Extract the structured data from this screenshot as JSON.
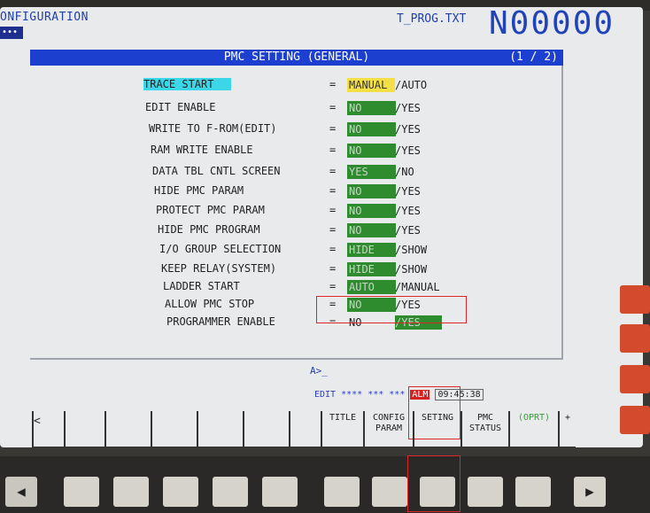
{
  "header": {
    "title": "ONFIGURATION",
    "dots": "•••",
    "program_file": "T_PROG.TXT",
    "program_number": "N00000"
  },
  "titlebar": {
    "title": "PMC SETTING (GENERAL)",
    "page": "(1 / 2)"
  },
  "settings": [
    {
      "label": "TRACE START",
      "eq": "=",
      "opt1": "MANUAL",
      "opt2": "/AUTO",
      "selected": 1,
      "highlight": true
    },
    {
      "label": "EDIT ENABLE",
      "eq": "=",
      "opt1": "NO",
      "opt2": "/YES",
      "selected": 1
    },
    {
      "label": "WRITE TO F-ROM(EDIT)",
      "eq": "=",
      "opt1": "NO",
      "opt2": "/YES",
      "selected": 1
    },
    {
      "label": "RAM WRITE ENABLE",
      "eq": "=",
      "opt1": "NO",
      "opt2": "/YES",
      "selected": 1
    },
    {
      "label": "DATA TBL CNTL SCREEN",
      "eq": "=",
      "opt1": "YES",
      "opt2": "/NO",
      "selected": 1
    },
    {
      "label": "HIDE PMC PARAM",
      "eq": "=",
      "opt1": "NO",
      "opt2": "/YES",
      "selected": 1
    },
    {
      "label": "PROTECT PMC PARAM",
      "eq": "=",
      "opt1": "NO",
      "opt2": "/YES",
      "selected": 1
    },
    {
      "label": "HIDE PMC PROGRAM",
      "eq": "=",
      "opt1": "NO",
      "opt2": "/YES",
      "selected": 1
    },
    {
      "label": "I/O GROUP SELECTION",
      "eq": "=",
      "opt1": "HIDE",
      "opt2": "/SHOW",
      "selected": 1
    },
    {
      "label": "KEEP RELAY(SYSTEM)",
      "eq": "=",
      "opt1": "HIDE",
      "opt2": "/SHOW",
      "selected": 1
    },
    {
      "label": "LADDER START",
      "eq": "=",
      "opt1": "AUTO",
      "opt2": "/MANUAL",
      "selected": 1
    },
    {
      "label": "ALLOW PMC STOP",
      "eq": "=",
      "opt1": "NO",
      "opt2": "/YES",
      "selected": 1
    },
    {
      "label": "PROGRAMMER ENABLE",
      "eq": "=",
      "opt1": "NO",
      "opt2": "/YES",
      "selected": 2
    }
  ],
  "command_line": "A>_",
  "status": {
    "mode": "EDIT **** *** ***",
    "alarm": "ALM",
    "time": "09:45:38"
  },
  "softkeys": {
    "left_arrow": "<",
    "title": "TITLE",
    "config_param": "CONFIG PARAM",
    "setting": "SETING",
    "pmc_status": "PMC STATUS",
    "oprt": "(OPRT)",
    "plus": "+"
  },
  "bottom_keys": {
    "left": "◀",
    "right": "▶"
  },
  "colors": {
    "title_bg": "#1d3fd0",
    "selected_bg": "#2e8b2e",
    "highlight_bg": "#3bd7e8",
    "manual_bg": "#f3e046",
    "annotation_red": "#e0242b"
  }
}
